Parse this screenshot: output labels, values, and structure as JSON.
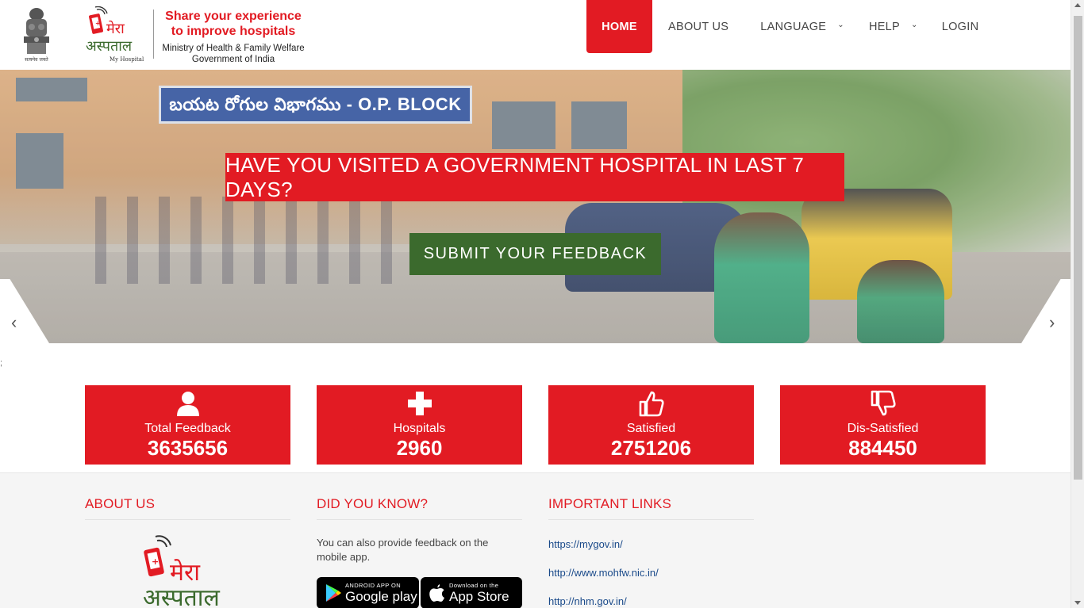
{
  "header": {
    "emblem_caption": "सत्यमेव जयते",
    "brand_name_hi": "मेरा अस्पताल",
    "brand_name_en": "My Hospital",
    "tagline_line1": "Share your experience",
    "tagline_line2": "to improve hospitals",
    "ministry_line1": "Ministry of Health & Family Welfare",
    "ministry_line2": "Government of India"
  },
  "nav": {
    "items": [
      {
        "label": "HOME",
        "active": true
      },
      {
        "label": "ABOUT US"
      },
      {
        "label": "LANGUAGE",
        "dropdown": true
      },
      {
        "label": "HELP",
        "dropdown": true
      },
      {
        "label": "LOGIN"
      }
    ]
  },
  "hero": {
    "signboard": "బయట రోగుల విభాగము - O.P. BLOCK",
    "question": "HAVE YOU VISITED A GOVERNMENT HOSPITAL IN LAST 7 DAYS?",
    "cta": "SUBMIT YOUR FEEDBACK"
  },
  "stray_text": ";",
  "stats": [
    {
      "label": "Total Feedback",
      "value": "3635656",
      "icon": "user-icon"
    },
    {
      "label": "Hospitals",
      "value": "2960",
      "icon": "plus-icon"
    },
    {
      "label": "Satisfied",
      "value": "2751206",
      "icon": "thumbs-up-icon"
    },
    {
      "label": "Dis-Satisfied",
      "value": "884450",
      "icon": "thumbs-down-icon"
    }
  ],
  "about": {
    "title": "ABOUT US",
    "logo_text_hi": "मेरा अस्पताल"
  },
  "did_you_know": {
    "title": "DID YOU KNOW?",
    "text": "You can also provide feedback on the mobile app.",
    "google_play_small": "ANDROID APP ON",
    "google_play_big": "Google play",
    "app_store_small": "Download on the",
    "app_store_big": "App Store"
  },
  "links": {
    "title": "IMPORTANT LINKS",
    "items": [
      "https://mygov.in/",
      "http://www.mohfw.nic.in/",
      "http://nhm.gov.in/"
    ]
  },
  "colors": {
    "brand_red": "#e21b23",
    "cta_green": "#3b6a2d",
    "link_blue": "#1a4a8a"
  }
}
